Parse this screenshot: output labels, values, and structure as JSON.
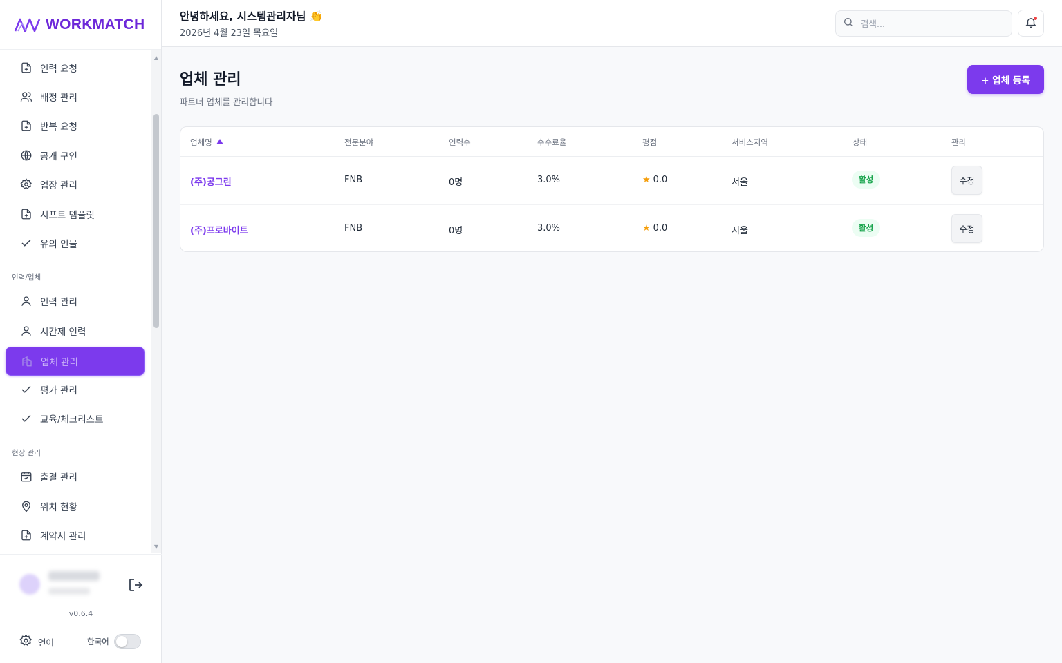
{
  "app": {
    "logo_text": "WORKMATCH",
    "version": "v0.6.4"
  },
  "header": {
    "greeting": "안녕하세요, 시스템관리자님 👏",
    "date": "2026년 4월 23일 목요일",
    "search_placeholder": "검색..."
  },
  "sidebar": {
    "items": [
      {
        "label": "인력 요청",
        "icon": "file-plus-icon"
      },
      {
        "label": "배정 관리",
        "icon": "users-icon"
      },
      {
        "label": "반복 요청",
        "icon": "file-plus-icon"
      },
      {
        "label": "공개 구인",
        "icon": "globe-icon"
      },
      {
        "label": "업장 관리",
        "icon": "gear-icon"
      },
      {
        "label": "시프트 템플릿",
        "icon": "file-plus-icon"
      },
      {
        "label": "유의 인물",
        "icon": "check-icon"
      }
    ],
    "section_workforce": "인력/업체",
    "workforce_items": [
      {
        "label": "인력 관리",
        "icon": "user-icon"
      },
      {
        "label": "시간제 인력",
        "icon": "user-icon"
      },
      {
        "label": "업체 관리",
        "icon": "building-icon",
        "active": true
      },
      {
        "label": "평가 관리",
        "icon": "check-icon"
      },
      {
        "label": "교육/체크리스트",
        "icon": "check-icon"
      }
    ],
    "section_site": "현장 관리",
    "site_items": [
      {
        "label": "출결 관리",
        "icon": "calendar-icon"
      },
      {
        "label": "위치 현황",
        "icon": "map-pin-icon"
      },
      {
        "label": "계약서 관리",
        "icon": "file-plus-icon"
      }
    ]
  },
  "footer": {
    "language_label": "언어",
    "language_value": "한국어"
  },
  "page": {
    "title": "업체 관리",
    "subtitle": "파트너 업체를 관리합니다",
    "add_button": "+ 업체 등록"
  },
  "table": {
    "columns": [
      "업체명",
      "전문분야",
      "인력수",
      "수수료율",
      "평점",
      "서비스지역",
      "상태",
      "관리"
    ],
    "rows": [
      {
        "name": "(주)공그린",
        "field": "FNB",
        "count": "0명",
        "fee": "3.0%",
        "rating": "0.0",
        "region": "서울",
        "status": "활성",
        "action": "수정"
      },
      {
        "name": "(주)프로바이트",
        "field": "FNB",
        "count": "0명",
        "fee": "3.0%",
        "rating": "0.0",
        "region": "서울",
        "status": "활성",
        "action": "수정"
      }
    ]
  },
  "colors": {
    "accent": "#7c3aed",
    "status_active_bg": "#ecfdf3",
    "status_active_text": "#16a34a",
    "star": "#f59e0b"
  }
}
